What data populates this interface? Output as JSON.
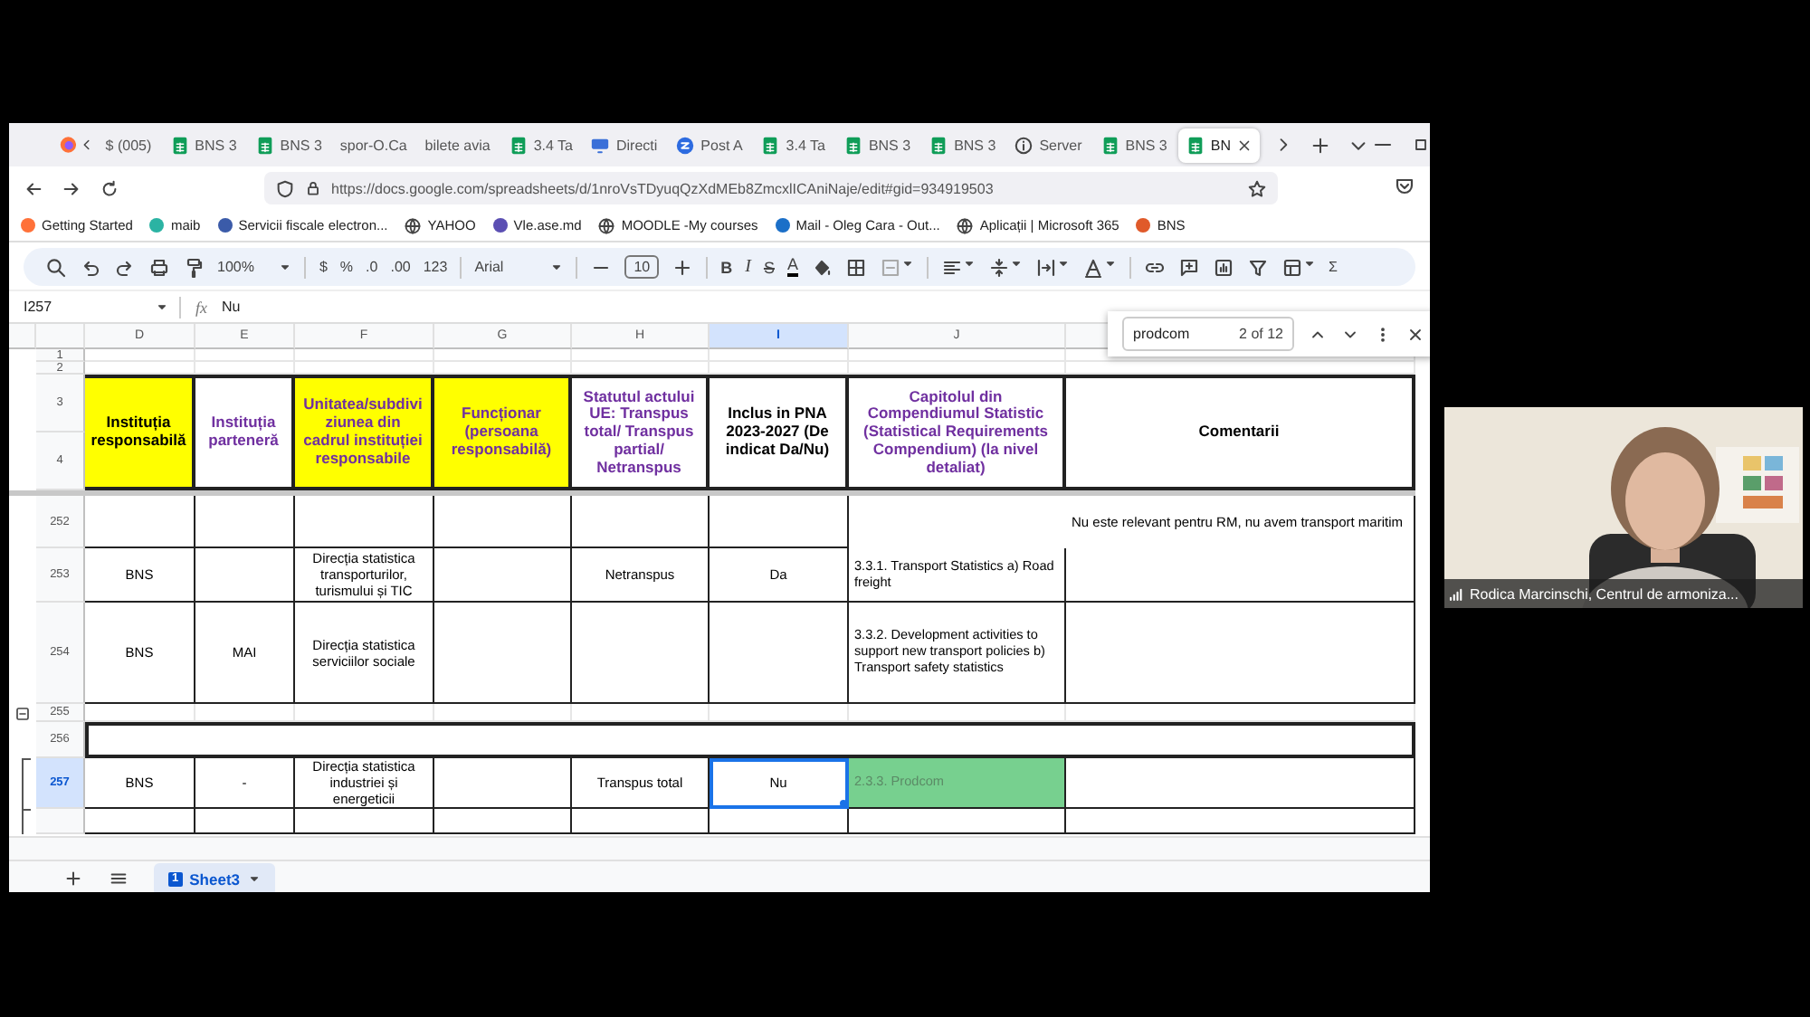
{
  "browser": {
    "tabs": [
      {
        "label": "$ (005)",
        "kind": "none",
        "selected": false
      },
      {
        "label": "BNS 3",
        "kind": "sheet",
        "selected": false
      },
      {
        "label": "BNS 3",
        "kind": "sheet",
        "selected": false
      },
      {
        "label": "spor-O.Ca",
        "kind": "none",
        "selected": false
      },
      {
        "label": "bilete avia",
        "kind": "none",
        "selected": false
      },
      {
        "label": "3.4 Ta",
        "kind": "sheet",
        "selected": false
      },
      {
        "label": "Directi",
        "kind": "monitor",
        "selected": false
      },
      {
        "label": "Post A",
        "kind": "circle",
        "selected": false
      },
      {
        "label": "3.4 Ta",
        "kind": "sheet",
        "selected": false
      },
      {
        "label": "BNS 3",
        "kind": "sheet",
        "selected": false
      },
      {
        "label": "BNS 3",
        "kind": "sheet",
        "selected": false
      },
      {
        "label": "Server",
        "kind": "info",
        "selected": false
      },
      {
        "label": "BNS 3",
        "kind": "sheet",
        "selected": false
      },
      {
        "label": "BN",
        "kind": "sheet",
        "selected": true
      }
    ],
    "url": "https://docs.google.com/spreadsheets/d/1nroVsTDyuqQzXdMEb8ZmcxlICAniNaje/edit#gid=934919503",
    "bookmarks": [
      {
        "label": "Getting Started",
        "kind": "logo",
        "color": "#ff7139"
      },
      {
        "label": "maib",
        "kind": "logo",
        "color": "#2bb3a3"
      },
      {
        "label": "Servicii fiscale electron...",
        "kind": "logo",
        "color": "#3b5ba9"
      },
      {
        "label": "YAHOO",
        "kind": "globe"
      },
      {
        "label": "Vle.ase.md",
        "kind": "logo",
        "color": "#5b4fb3"
      },
      {
        "label": "MOODLE -My courses",
        "kind": "globe"
      },
      {
        "label": "Mail - Oleg Cara - Out...",
        "kind": "logo",
        "color": "#1b6fc8"
      },
      {
        "label": "Aplicații | Microsoft 365",
        "kind": "globe"
      },
      {
        "label": "BNS",
        "kind": "logo",
        "color": "#e05a2a"
      }
    ]
  },
  "toolbar": {
    "zoom": "100%",
    "currency": "$",
    "percent": "%",
    "decrease_decimals": ".0",
    "increase_decimals": ".00",
    "number_format": "123",
    "font": "Arial",
    "font_size": "10",
    "bold": "B",
    "italic": "I",
    "strikethrough": "S",
    "text_color": "A",
    "functions": "Σ"
  },
  "formula_bar": {
    "cell": "I257",
    "fx": "fx",
    "value": "Nu"
  },
  "find": {
    "query": "prodcom",
    "count": "2 of 12"
  },
  "columns": [
    {
      "label": "D",
      "selected": false
    },
    {
      "label": "E",
      "selected": false
    },
    {
      "label": "F",
      "selected": false
    },
    {
      "label": "G",
      "selected": false
    },
    {
      "label": "H",
      "selected": false
    },
    {
      "label": "I",
      "selected": true
    },
    {
      "label": "J",
      "selected": false
    }
  ],
  "rows": [
    {
      "numbers": [
        "1"
      ],
      "kind": "blank",
      "selected": false
    },
    {
      "numbers": [
        "2"
      ],
      "kind": "blank",
      "selected": false
    },
    {
      "numbers": [
        "3",
        "4"
      ],
      "kind": "header",
      "selected": false,
      "cells": [
        {
          "text": "Instituția responsabilă",
          "color": "#ffff00",
          "kind": "plain",
          "selected": false
        },
        {
          "text": "Instituția parteneră",
          "color": "#ffffff",
          "kind": "accent",
          "selected": false
        },
        {
          "text": "Unitatea/subdiviziunea din cadrul instituției responsabile",
          "color": "#ffff00",
          "kind": "accent",
          "selected": false
        },
        {
          "text": "Funcționar (persoana responsabilă)",
          "color": "#ffff00",
          "kind": "accent",
          "selected": false
        },
        {
          "text": "Statutul actului UE: Transpus total/ Transpus partial/ Netranspus",
          "color": "#ffffff",
          "kind": "accent",
          "selected": false
        },
        {
          "text": "Inclus in PNA 2023-2027 (De indicat Da/Nu)",
          "color": "#ffffff",
          "kind": "plain",
          "selected": false
        },
        {
          "text": "Capitolul din Compendiumul Statistic (Statistical Requirements Compendium) (la nivel detaliat)",
          "color": "#ffffff",
          "kind": "accent",
          "selected": false
        },
        {
          "text": "Comentarii",
          "color": "#ffffff",
          "kind": "plain",
          "selected": false
        }
      ]
    },
    {
      "numbers": [
        "252"
      ],
      "kind": "table",
      "selected": false,
      "cells": [
        {
          "selected": false
        },
        {
          "selected": false
        },
        {
          "selected": false
        },
        {
          "selected": false
        },
        {
          "selected": false
        },
        {
          "selected": false
        },
        {
          "text": "Nu este relevant pentru RM, nu avem transport maritim",
          "kind": "note",
          "selected": false
        }
      ]
    },
    {
      "numbers": [
        "253"
      ],
      "kind": "table",
      "selected": false,
      "cells": [
        {
          "text": "BNS",
          "selected": false
        },
        {
          "selected": false
        },
        {
          "text": "Direcția statistica transporturilor, turismului și TIC",
          "selected": false
        },
        {
          "selected": false
        },
        {
          "text": "Netranspus",
          "selected": false
        },
        {
          "text": "Da",
          "selected": false
        },
        {
          "text": "3.3.1. Transport Statistics  a) Road freight",
          "kind": "left",
          "selected": false
        },
        {
          "selected": false
        }
      ]
    },
    {
      "numbers": [
        "254"
      ],
      "kind": "table",
      "selected": false,
      "cells": [
        {
          "text": "BNS",
          "selected": false
        },
        {
          "text": "MAI",
          "selected": false
        },
        {
          "text": "Direcția statistica serviciilor sociale",
          "selected": false
        },
        {
          "selected": false
        },
        {
          "selected": false
        },
        {
          "selected": false
        },
        {
          "text": "3.3.2. Development activities to support new transport policies   b) Transport safety statistics",
          "kind": "left",
          "selected": false
        },
        {
          "selected": false
        }
      ]
    },
    {
      "numbers": [
        "255"
      ],
      "kind": "blank",
      "selected": false,
      "group_toggle": {
        "expanded": true
      }
    },
    {
      "numbers": [
        "256"
      ],
      "kind": "band",
      "selected": false,
      "cells": [
        {
          "selected": false
        }
      ]
    },
    {
      "numbers": [
        "257"
      ],
      "kind": "table",
      "selected": true,
      "grouped": true,
      "cells": [
        {
          "text": "BNS",
          "selected": false
        },
        {
          "text": "-",
          "selected": false
        },
        {
          "text": "Direcția statistica industriei și energeticii",
          "selected": false
        },
        {
          "selected": false
        },
        {
          "text": "Transpus total",
          "selected": false
        },
        {
          "text": "Nu",
          "selected": true
        },
        {
          "text": "2.3.3. Prodcom",
          "kind": "match",
          "color": "#77d08f",
          "selected": false
        },
        {
          "selected": false
        }
      ]
    },
    {
      "kind": "table",
      "selected": false,
      "grouped": true,
      "cells": [
        {
          "selected": false
        },
        {
          "selected": false
        },
        {
          "selected": false
        },
        {
          "selected": false
        },
        {
          "selected": false
        },
        {
          "selected": false
        },
        {
          "selected": false
        },
        {
          "selected": false
        }
      ]
    }
  ],
  "sheet_tabs": [
    {
      "badge": "1",
      "label": "Sheet3",
      "selected": true
    }
  ],
  "video": {
    "name": "Rodica Marcinschi, Centrul de armoniza..."
  }
}
